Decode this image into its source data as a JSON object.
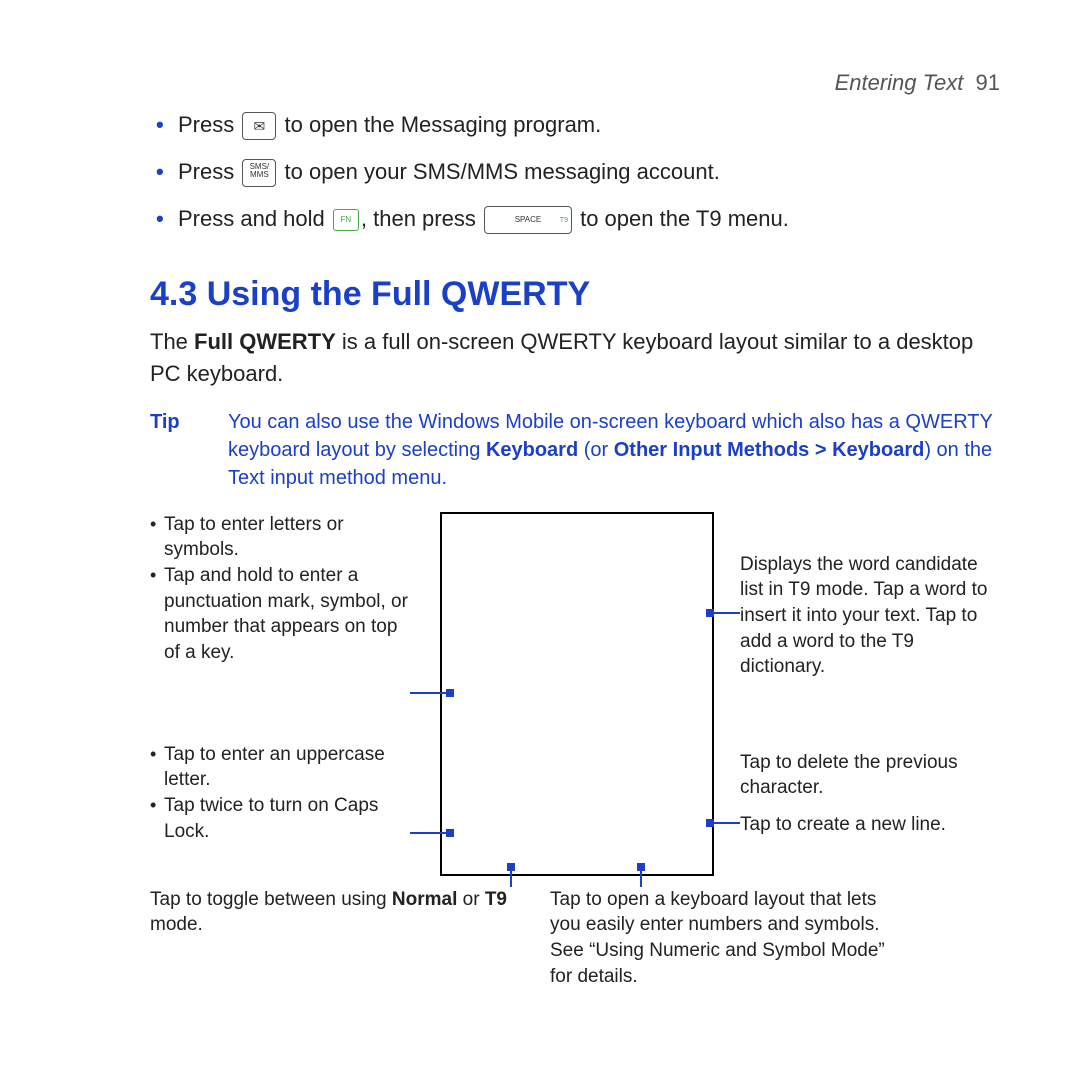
{
  "header": {
    "chapter": "Entering Text",
    "page": "91"
  },
  "bullets": {
    "b1a": "Press",
    "b1b": "to open the Messaging program.",
    "b2a": "Press",
    "b2b": "to open your SMS/MMS messaging account.",
    "b3a": "Press and hold",
    "b3b": ", then press",
    "b3c": "to open the T9 menu."
  },
  "keys": {
    "envelope": "✉",
    "sms1": "SMS/",
    "sms2": "MMS",
    "fn": "FN",
    "space": "SPACE",
    "t9": "T9"
  },
  "section": {
    "title": "4.3 Using the Full QWERTY",
    "lead_a": "The ",
    "lead_b": "Full QWERTY",
    "lead_c": " is a full on-screen QWERTY keyboard layout similar to a desktop PC keyboard."
  },
  "tip": {
    "label": "Tip",
    "t1": "You can also use the Windows Mobile on-screen keyboard which also has a QWERTY keyboard layout by selecting ",
    "b1": "Keyboard",
    "t2": " (or ",
    "b2": "Other Input Methods > Keyboard",
    "t3": ") on the Text input method menu."
  },
  "callouts": {
    "left1a": "Tap to enter letters or symbols.",
    "left1b": "Tap and hold to enter a punctuation mark, symbol, or number that appears on top of a key.",
    "left2a": "Tap to enter an uppercase letter.",
    "left2b": "Tap twice to turn on Caps Lock.",
    "right1": "Displays the word candidate list in T9 mode. Tap a word to insert it into your text. Tap       to add a word to the T9 dictionary.",
    "right2": "Tap to delete the previous character.",
    "right3": "Tap to create a new line.",
    "bottomL_a": "Tap to toggle between using ",
    "bottomL_b": "Normal",
    "bottomL_c": " or ",
    "bottomL_d": "T9",
    "bottomL_e": " mode.",
    "bottomR": "Tap to open a keyboard layout that lets you easily enter numbers and symbols. See “Using Numeric and Symbol Mode” for details."
  }
}
